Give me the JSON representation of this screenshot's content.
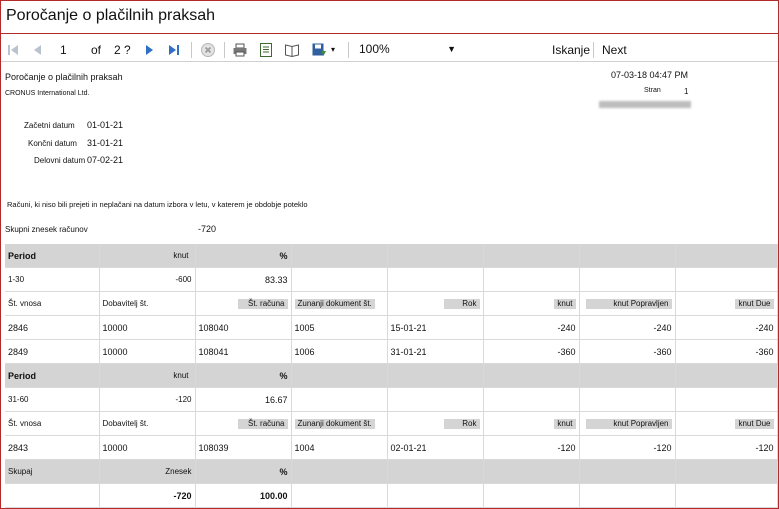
{
  "window": {
    "title": "Poročanje o plačilnih praksah"
  },
  "toolbar": {
    "page_current": "1",
    "page_of": "of",
    "page_total": "2 ?",
    "zoom": "100%",
    "find_label": "Iskanje",
    "next_label": "Next"
  },
  "report": {
    "title": "Poročanje o plačilnih praksah",
    "company": "CRONUS International Ltd.",
    "datetime": "07-03-18 04:47 PM",
    "page_label": "Stran",
    "page_number": "1",
    "start_date_label": "Začetni datum",
    "start_date": "01-01-21",
    "end_date_label": "Končni datum",
    "end_date": "31-01-21",
    "work_date_label": "Delovni datum",
    "work_date": "07-02-21",
    "description": "Računi, ki niso bili prejeti in neplačani na datum izbora v letu, v katerem je obdobje poteklo",
    "total_label": "Skupni znesek računov",
    "total_value": "-720"
  },
  "columns": {
    "period": "Period",
    "knut": "knut",
    "percent": "%",
    "entry_no": "Št. vnosa",
    "vendor_no": "Dobavitelj št.",
    "invoice_no": "Št. računa",
    "ext_doc_no": "Zunanji dokument št.",
    "due": "Rok",
    "knut_corr": "knut Popravljen",
    "knut_due": "knut Due"
  },
  "groups": [
    {
      "period": "1-30",
      "amount": "-600",
      "percent": "83.33",
      "rows": [
        {
          "entry": "2846",
          "vendor": "10000",
          "invoice": "108040",
          "ext": "1005",
          "due": "15-01-21",
          "amount": "-240",
          "corrected": "-240",
          "due_amount": "-240"
        },
        {
          "entry": "2849",
          "vendor": "10000",
          "invoice": "108041",
          "ext": "1006",
          "due": "31-01-21",
          "amount": "-360",
          "corrected": "-360",
          "due_amount": "-360"
        }
      ]
    },
    {
      "period": "31-60",
      "amount": "-120",
      "percent": "16.67",
      "rows": [
        {
          "entry": "2843",
          "vendor": "10000",
          "invoice": "108039",
          "ext": "1004",
          "due": "02-01-21",
          "amount": "-120",
          "corrected": "-120",
          "due_amount": "-120"
        }
      ]
    }
  ],
  "totals": {
    "label": "Skupaj",
    "amount_label": "Znesek",
    "percent_label": "%",
    "amount": "-720",
    "percent": "100.00"
  }
}
